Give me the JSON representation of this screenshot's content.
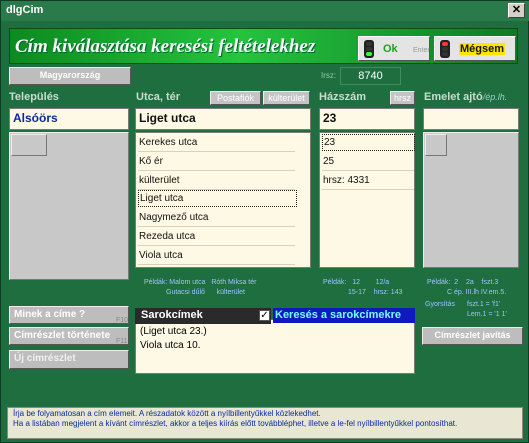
{
  "window": {
    "title": "dlgCim",
    "close": "✕"
  },
  "banner": {
    "title": "Cím kiválasztása keresési feltételekhez"
  },
  "ok": {
    "label": "Ok",
    "shortcut": "Enter"
  },
  "cancel": {
    "label": "Mégsem"
  },
  "country_button": "Magyarország",
  "irsz": {
    "label": "Irsz:",
    "value": "8740"
  },
  "columns": {
    "settlement": {
      "header": "Település",
      "value": "Alsóörs"
    },
    "street": {
      "header": "Utca, tér",
      "value": "Liget utca",
      "btn_postafiok": "Postafiók",
      "btn_kulterulet": "külterület"
    },
    "house": {
      "header": "Házszám",
      "value": "23",
      "btn_hrsz": "hrsz"
    },
    "floor": {
      "header": "Emelet ajtó",
      "suffix": "/ép.lh."
    }
  },
  "street_list": [
    "Kerekes utca",
    "Kő ér",
    "külterület",
    "Liget utca",
    "Nagymező utca",
    "Rezeda utca",
    "Viola utca"
  ],
  "house_list": [
    "23",
    "25",
    "hrsz: 4331"
  ],
  "examples": {
    "street": {
      "l1a": "Példák: Malom utca",
      "l1b": "Róth Miksa tér",
      "l2a": "Gutacsi dűlő",
      "l2b": "külterület"
    },
    "house": {
      "l1a": "Példák:",
      "l1b": "12",
      "l1c": "12/a",
      "l2a": "15-17",
      "l2b": "hrsz: 143"
    },
    "floor": {
      "l1a": "Példák:",
      "l1b": "2",
      "l1c": "2a",
      "l1d": "fszt.3",
      "l2": "C ép. III.lh IV.em.5."
    },
    "gyors": {
      "label": "Gyorsítás",
      "l1": "fszt.1 = 'f1'",
      "l2": "Lem.1 = '1 1'"
    }
  },
  "left_buttons": {
    "what": "Minek a címe ?",
    "what_key": "F10",
    "history": "Címrészlet története",
    "history_key": "F11",
    "new": "Új címrészlet"
  },
  "corner": {
    "title": "Sarokcímek",
    "check": "✓",
    "check_label": "Keresés a sarokcímekre",
    "lines": [
      "(Liget utca  23.)",
      "Viola utca  10."
    ]
  },
  "fix_button": "Címrészlet javítás",
  "help": {
    "text": "Írja be folyamatosan a cím elemeit. A részadatok között a nyílbillentyűkkel közlekedhet.\nHa a listában megjelent a kívánt címrészlet, akkor a teljes kiírás előtt továbbléphet, illetve a le-fel nyílbillentyűkkel pontosíthat."
  }
}
